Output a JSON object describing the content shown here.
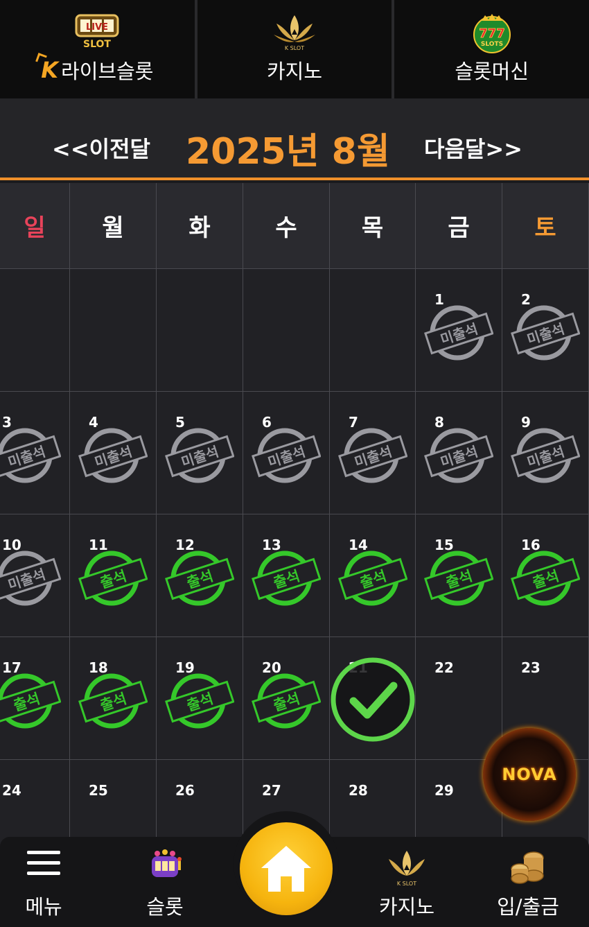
{
  "top_tabs": [
    {
      "label": "라이브슬롯",
      "logo_letter": "K",
      "icon": "live-slot-icon"
    },
    {
      "label": "카지노",
      "icon": "kslot-lotus-icon"
    },
    {
      "label": "슬롯머신",
      "icon": "777-slots-icon"
    }
  ],
  "month_nav": {
    "prev_label": "<<이전달",
    "title": "2025년 8월",
    "next_label": "다음달>>"
  },
  "weekdays": [
    "일",
    "월",
    "화",
    "수",
    "목",
    "금",
    "토"
  ],
  "weekday_colors": {
    "sunday": "#e8435a",
    "saturday": "#f59a33",
    "weekday": "#ffffff"
  },
  "stamp_texts": {
    "absent": "미출석",
    "present": "출석"
  },
  "stamp_colors": {
    "absent": "#9a9aa0",
    "present": "#35c82a"
  },
  "calendar": {
    "first_weekday": 5,
    "visible_rows": 5,
    "days": [
      {
        "day": "1",
        "status": "absent"
      },
      {
        "day": "2",
        "status": "absent"
      },
      {
        "day": "3",
        "status": "absent"
      },
      {
        "day": "4",
        "status": "absent"
      },
      {
        "day": "5",
        "status": "absent"
      },
      {
        "day": "6",
        "status": "absent"
      },
      {
        "day": "7",
        "status": "absent"
      },
      {
        "day": "8",
        "status": "absent"
      },
      {
        "day": "9",
        "status": "absent"
      },
      {
        "day": "10",
        "status": "absent"
      },
      {
        "day": "11",
        "status": "present"
      },
      {
        "day": "12",
        "status": "present"
      },
      {
        "day": "13",
        "status": "present"
      },
      {
        "day": "14",
        "status": "present"
      },
      {
        "day": "15",
        "status": "present"
      },
      {
        "day": "16",
        "status": "present"
      },
      {
        "day": "17",
        "status": "present"
      },
      {
        "day": "18",
        "status": "present"
      },
      {
        "day": "19",
        "status": "present"
      },
      {
        "day": "20",
        "status": "present"
      },
      {
        "day": "21",
        "status": "today-checked"
      },
      {
        "day": "22",
        "status": "none"
      },
      {
        "day": "23",
        "status": "none"
      },
      {
        "day": "24",
        "status": "none"
      },
      {
        "day": "25",
        "status": "none"
      },
      {
        "day": "26",
        "status": "none"
      },
      {
        "day": "27",
        "status": "none"
      },
      {
        "day": "28",
        "status": "none"
      },
      {
        "day": "29",
        "status": "none"
      }
    ]
  },
  "floating_button": {
    "label": "NOVA",
    "icon": "nova-logo-icon"
  },
  "bottom_nav": {
    "menu_label": "메뉴",
    "slot_label": "슬롯",
    "casino_label": "카지노",
    "deposit_label": "입/출금",
    "home_icon": "home-icon"
  }
}
